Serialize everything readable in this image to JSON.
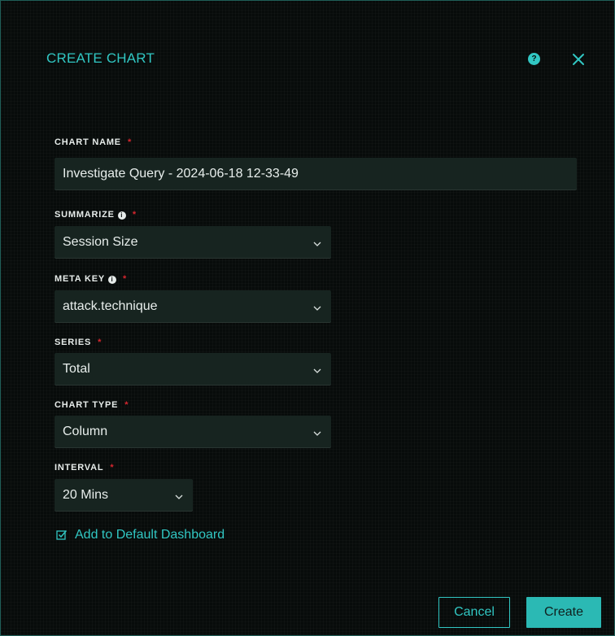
{
  "dialog": {
    "title": "CREATE CHART",
    "help_icon_glyph": "?",
    "close_icon": "close-icon",
    "accent_color": "#31c7c3",
    "required_color": "#d6272f"
  },
  "form": {
    "chart_name": {
      "label": "CHART NAME",
      "required_mark": "*",
      "value": "Investigate Query - 2024-06-18 12-33-49"
    },
    "summarize": {
      "label": "SUMMARIZE",
      "info_glyph": "i",
      "required_mark": "*",
      "value": "Session Size"
    },
    "meta_key": {
      "label": "META KEY",
      "info_glyph": "i",
      "required_mark": "*",
      "value": "attack.technique"
    },
    "series": {
      "label": "SERIES",
      "required_mark": "*",
      "value": "Total"
    },
    "chart_type": {
      "label": "CHART TYPE",
      "required_mark": "*",
      "value": "Column"
    },
    "interval": {
      "label": "INTERVAL",
      "required_mark": "*",
      "value": "20 Mins"
    },
    "default_dashboard": {
      "label": "Add to Default Dashboard",
      "checked": true
    }
  },
  "actions": {
    "cancel_label": "Cancel",
    "create_label": "Create"
  }
}
